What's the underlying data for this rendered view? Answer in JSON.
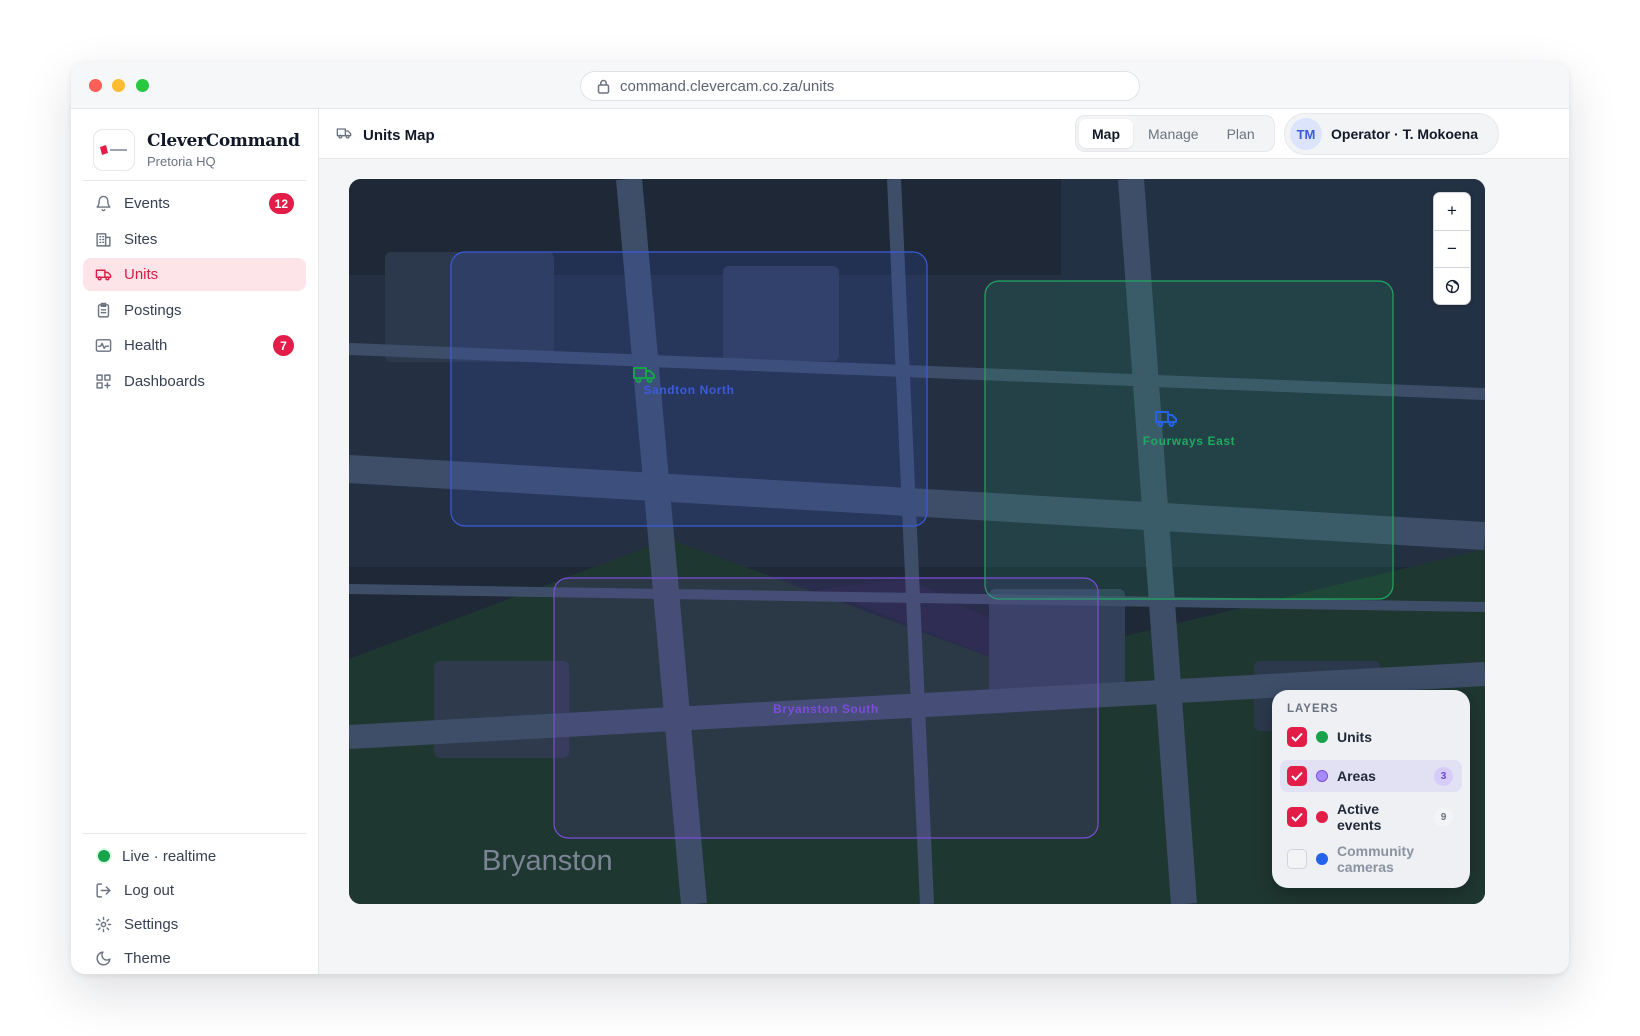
{
  "browser": {
    "url": "command.clevercam.co.za/units"
  },
  "brand": {
    "name": "CleverCommand",
    "subtitle": "Pretoria HQ"
  },
  "sidebar": {
    "items": [
      {
        "label": "Events",
        "icon": "bell-icon",
        "badge": "12"
      },
      {
        "label": "Sites",
        "icon": "building-icon"
      },
      {
        "label": "Units",
        "icon": "truck-icon",
        "active": true
      },
      {
        "label": "Postings",
        "icon": "clipboard-icon"
      },
      {
        "label": "Health",
        "icon": "activity-icon",
        "badge": "7"
      },
      {
        "label": "Dashboards",
        "icon": "grid-icon"
      }
    ],
    "bottom": {
      "live": "Live · realtime",
      "logout": "Log out",
      "settings": "Settings",
      "theme": "Theme"
    }
  },
  "header": {
    "title": "Units Map",
    "tabs": [
      "Map",
      "Manage",
      "Plan"
    ],
    "active_tab": "Map",
    "user": {
      "initials": "TM",
      "name": "Operator · T. Mokoena"
    }
  },
  "map": {
    "areas": [
      {
        "name": "Sandton North",
        "color": "#3b5bdb"
      },
      {
        "name": "Fourways East",
        "color": "#22a861"
      },
      {
        "name": "Bryanston South",
        "color": "#7c4ddb"
      }
    ],
    "units": [
      {
        "area": "Sandton North",
        "color": "#16a34a"
      },
      {
        "area": "Fourways East",
        "color": "#2563eb"
      }
    ],
    "place_label": "Bryanston",
    "zoom_controls": {
      "zoom_in": "+",
      "zoom_out": "−",
      "globe": "globe-icon"
    },
    "layers": {
      "title": "LAYERS",
      "items": [
        {
          "name": "Units",
          "checked": true,
          "color": "#16a34a"
        },
        {
          "name": "Areas",
          "checked": true,
          "color": "#a78bfa",
          "count": "3",
          "highlighted": true
        },
        {
          "name": "Active events",
          "checked": true,
          "color": "#e11d48",
          "count": "9"
        },
        {
          "name": "Community cameras",
          "checked": false,
          "color": "#2563eb"
        }
      ]
    }
  },
  "colors": {
    "accent": "#e11d48",
    "active_bg": "#fde4e8",
    "map_bg": "#1e2836"
  }
}
